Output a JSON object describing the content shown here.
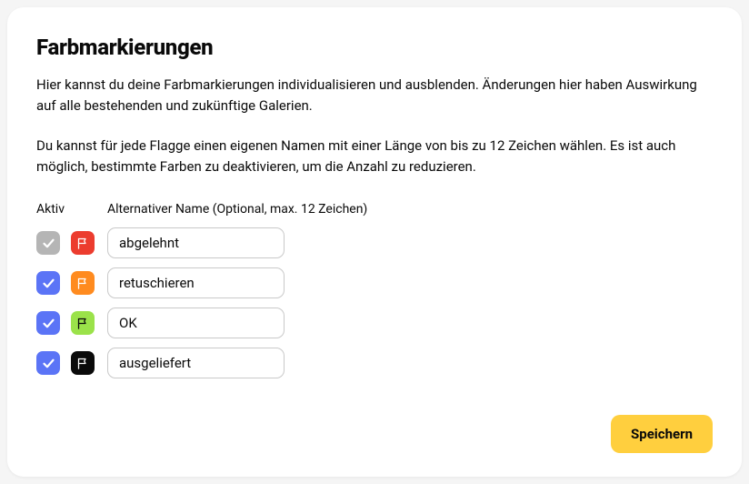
{
  "title": "Farbmarkierungen",
  "description": {
    "p1": "Hier kannst du deine Farbmarkierungen individualisieren und ausblenden. Änderungen hier haben Auswirkung auf alle bestehenden und zukünftige Galerien.",
    "p2": "Du kannst für jede Flagge einen eigenen Namen mit einer Länge von bis zu 12 Zeichen wählen. Es ist auch möglich, bestimmte Farben zu deaktivieren, um die Anzahl zu reduzieren."
  },
  "columns": {
    "active": "Aktiv",
    "name": "Alternativer Name (Optional, max. 12 Zeichen)"
  },
  "flags": [
    {
      "active": false,
      "color": "#ec3c2e",
      "iconStroke": "#ffffff",
      "value": "abgelehnt"
    },
    {
      "active": true,
      "color": "#ff8b1f",
      "iconStroke": "#ffffff",
      "value": "retuschieren"
    },
    {
      "active": true,
      "color": "#9be24a",
      "iconStroke": "#0a0a0a",
      "value": "OK"
    },
    {
      "active": true,
      "color": "#0a0a0a",
      "iconStroke": "#ffffff",
      "value": "ausgeliefert"
    }
  ],
  "buttons": {
    "save": "Speichern"
  }
}
